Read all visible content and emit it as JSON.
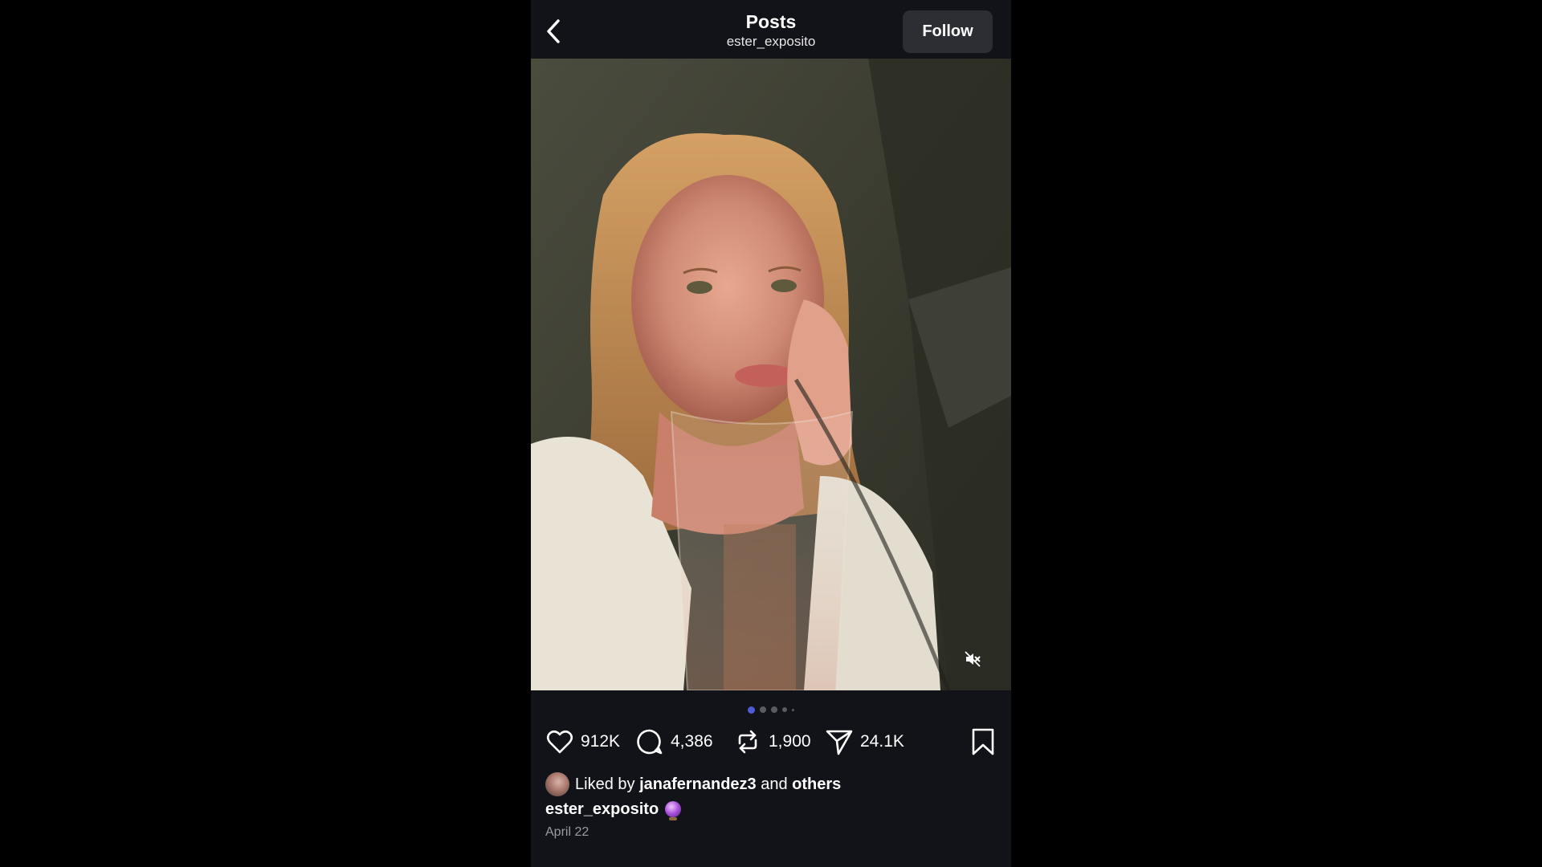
{
  "header": {
    "title": "Posts",
    "username": "ester_exposito",
    "follow_label": "Follow"
  },
  "media": {
    "carousel_total": 5,
    "carousel_active": 1,
    "mute_icon": "speaker-muted-icon"
  },
  "actions": {
    "likes": "912K",
    "comments": "4,386",
    "reposts": "1,900",
    "shares": "24.1K"
  },
  "liked_by": {
    "prefix": "Liked by",
    "user": "janafernandez3",
    "conjunction": "and",
    "others": "others"
  },
  "caption": {
    "username": "ester_exposito",
    "emoji": "crystal-ball-emoji"
  },
  "date": "April 22",
  "colors": {
    "background": "#000000",
    "panel": "#121318",
    "button": "#2c2e34",
    "accent_dot": "#4f5bd5",
    "muted_text": "#9a9ca3"
  }
}
